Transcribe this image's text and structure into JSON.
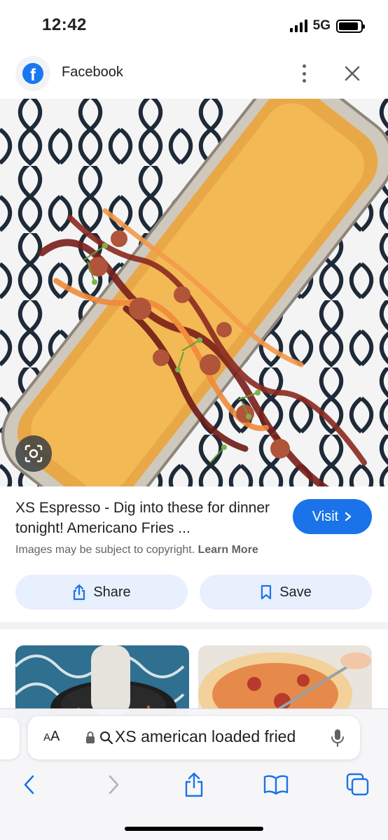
{
  "status_bar": {
    "time": "12:42",
    "network": "5G",
    "battery_level": 0.9
  },
  "source": {
    "name": "Facebook",
    "icon": "facebook-logo",
    "logo_letter": "f"
  },
  "caption": {
    "text": "XS Espresso - Dig into these for dinner tonight! Americano Fries ...",
    "visit_label": "Visit",
    "copyright_text": "Images may be subject to copyright.",
    "learn_more_label": "Learn More"
  },
  "actions": {
    "share_label": "Share",
    "save_label": "Save"
  },
  "browser": {
    "text_size_label_small": "A",
    "text_size_label_large": "A",
    "address_text": "XS american loaded fried",
    "icons": [
      "back-icon",
      "forward-icon",
      "share-icon",
      "bookmarks-icon",
      "tabs-icon"
    ]
  },
  "colors": {
    "accent": "#1a73e8",
    "button_bg": "#e8f0fe",
    "facebook_blue": "#1877f2"
  }
}
